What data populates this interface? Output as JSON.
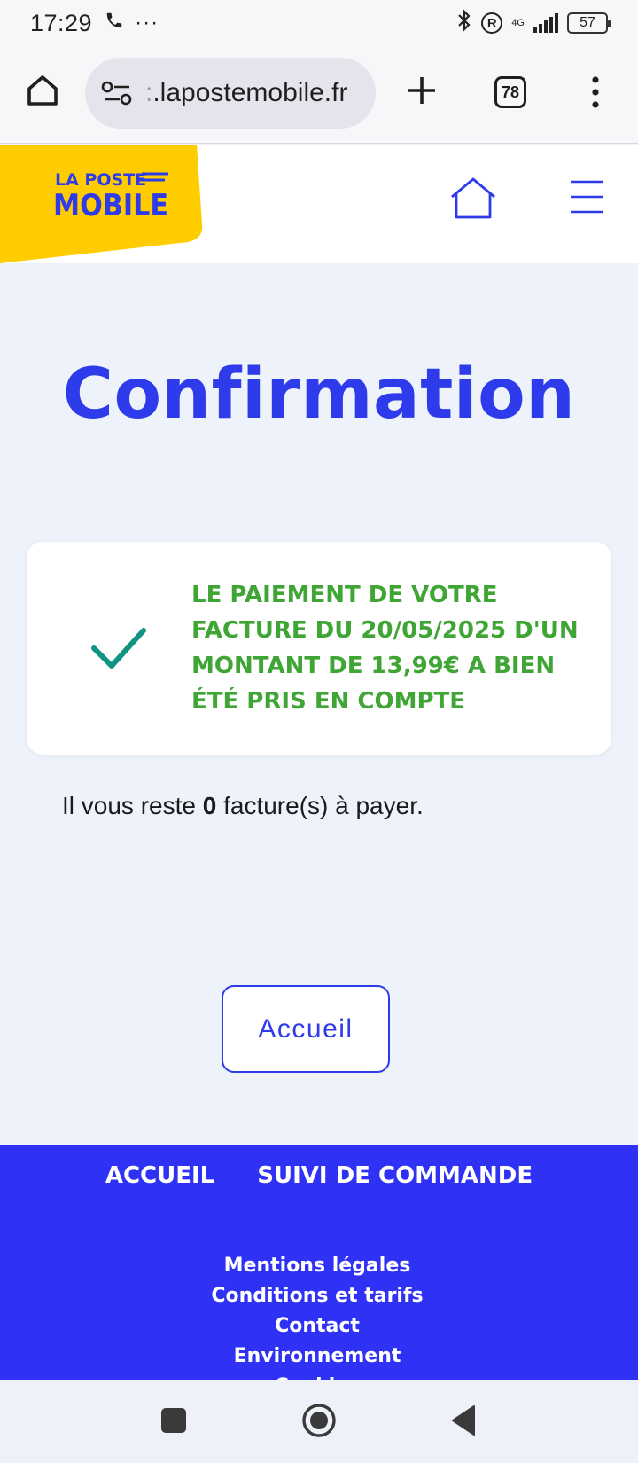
{
  "status_bar": {
    "time": "17:29",
    "call_icon": "phone-icon",
    "more": "···",
    "network": "4G",
    "battery": "57"
  },
  "browser": {
    "url": ".lapostemobile.fr",
    "url_fade": ":",
    "tab_count": "78"
  },
  "header": {
    "logo_line1": "LA POSTE",
    "logo_line2": "MOBILE",
    "brand_yellow": "#ffcc00",
    "brand_blue": "#2e3bea"
  },
  "main": {
    "title": "Confirmation",
    "message": "LE PAIEMENT DE VOTRE FACTURE DU 20/05/2025 D'UN MONTANT DE 13,99€ A BIEN ÉTÉ PRIS EN COMPTE",
    "remaining_prefix": "Il vous reste ",
    "remaining_count": "0",
    "remaining_suffix": " facture(s) à payer.",
    "button_label": "Accueil",
    "success_color": "#3fa535"
  },
  "footer": {
    "nav": [
      "ACCUEIL",
      "SUIVI DE COMMANDE"
    ],
    "links": [
      "Mentions légales",
      "Conditions et tarifs",
      "Contact",
      "Environnement",
      "Cookies"
    ],
    "background": "#2f32f5"
  }
}
